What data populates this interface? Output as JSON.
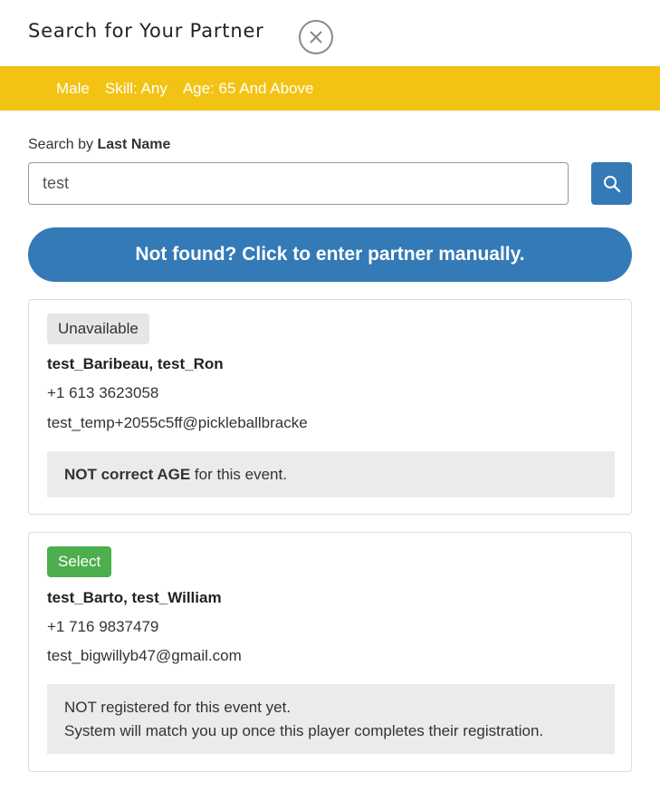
{
  "header": {
    "title": "Search for Your Partner"
  },
  "filters": {
    "gender": "Male",
    "skill": "Skill: Any",
    "age": "Age: 65 And Above"
  },
  "search": {
    "label_prefix": "Search by ",
    "label_bold": "Last Name",
    "value": "test"
  },
  "manual_button": {
    "label": "Not found? Click to enter partner manually."
  },
  "results": [
    {
      "status": "Unavailable",
      "name": "test_Baribeau, test_Ron",
      "phone": "+1 613 3623058",
      "email": "test_temp+2055c5ff@pickleballbracke",
      "note_bold": "NOT correct AGE",
      "note_rest": " for this event."
    },
    {
      "status": "Select",
      "name": "test_Barto, test_William",
      "phone": "+1 716 9837479",
      "email": "test_bigwillyb47@gmail.com",
      "note_line1": "NOT registered for this event yet.",
      "note_line2": "System will match you up once this player completes their registration."
    }
  ],
  "colors": {
    "accent": "#337ab7",
    "filter_bar": "#f2c314",
    "select": "#4cae4c"
  },
  "icons": {
    "close": "close-circle-icon",
    "search": "search-icon"
  }
}
